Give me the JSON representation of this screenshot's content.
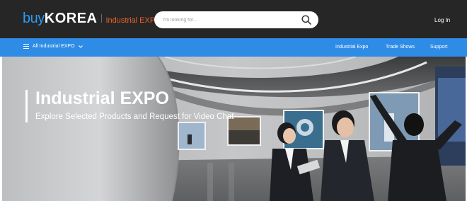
{
  "header": {
    "logo_buy": "buy",
    "logo_korea": "KOREA",
    "logo_section": "Industrial EXPO",
    "search_placeholder": "I'm looking for...",
    "search_value": "",
    "login_label": "Log In"
  },
  "nav": {
    "category_label": "All Industrial EXPO",
    "links": [
      "Industrial Expo",
      "Trade Shows",
      "Support"
    ]
  },
  "hero": {
    "title": "Industrial EXPO",
    "subtitle": "Explore Selected Products and Request for Video Chat"
  },
  "colors": {
    "header_bg": "#262626",
    "nav_bg": "#2e8ce6",
    "logo_blue": "#2d9bf0",
    "logo_orange": "#e8642a"
  },
  "icons": [
    "menu-icon",
    "chevron-down-icon",
    "search-icon"
  ]
}
